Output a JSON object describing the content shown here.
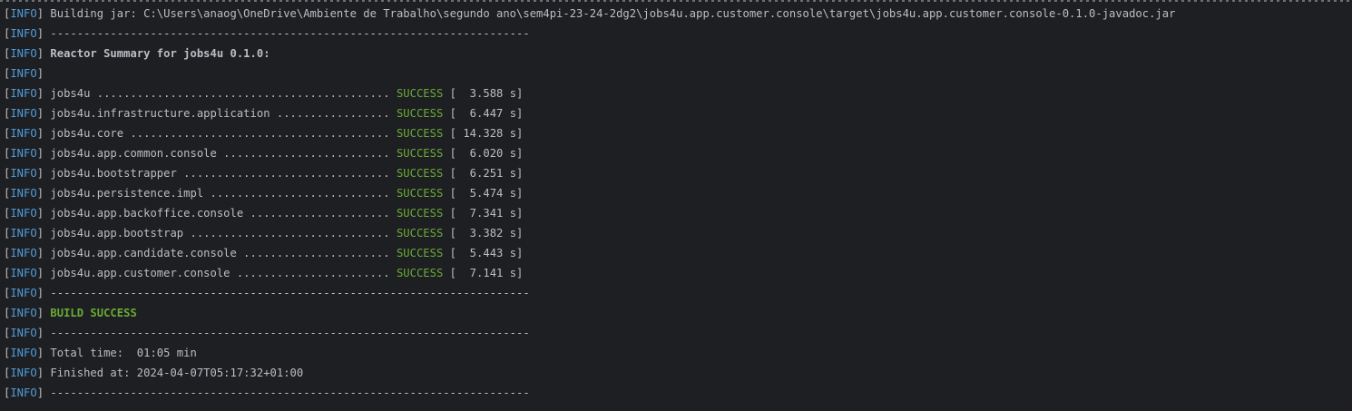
{
  "tag_open": "[",
  "tag_label": "INFO",
  "tag_close": "]",
  "colors": {
    "background": "#1e1f22",
    "text": "#bcbec4",
    "info_tag": "#4f9ddb",
    "success": "#6aab35"
  },
  "lines": {
    "building_jar": "Building jar: C:\\Users\\anaog\\OneDrive\\Ambiente de Trabalho\\segundo ano\\sem4pi-23-24-2dg2\\jobs4u.app.customer.console\\target\\jobs4u.app.customer.console-0.1.0-javadoc.jar",
    "separator": "------------------------------------------------------------------------",
    "reactor_summary": "Reactor Summary for jobs4u 0.1.0:",
    "empty": "",
    "build_success": "BUILD SUCCESS",
    "total_time": "Total time:  01:05 min",
    "finished_at": "Finished at: 2024-04-07T05:17:32+01:00"
  },
  "modules": [
    {
      "prefix": "jobs4u ............................................ ",
      "status": "SUCCESS",
      "time": " [  3.588 s]"
    },
    {
      "prefix": "jobs4u.infrastructure.application ................. ",
      "status": "SUCCESS",
      "time": " [  6.447 s]"
    },
    {
      "prefix": "jobs4u.core ....................................... ",
      "status": "SUCCESS",
      "time": " [ 14.328 s]"
    },
    {
      "prefix": "jobs4u.app.common.console ......................... ",
      "status": "SUCCESS",
      "time": " [  6.020 s]"
    },
    {
      "prefix": "jobs4u.bootstrapper ............................... ",
      "status": "SUCCESS",
      "time": " [  6.251 s]"
    },
    {
      "prefix": "jobs4u.persistence.impl ........................... ",
      "status": "SUCCESS",
      "time": " [  5.474 s]"
    },
    {
      "prefix": "jobs4u.app.backoffice.console ..................... ",
      "status": "SUCCESS",
      "time": " [  7.341 s]"
    },
    {
      "prefix": "jobs4u.app.bootstrap .............................. ",
      "status": "SUCCESS",
      "time": " [  3.382 s]"
    },
    {
      "prefix": "jobs4u.app.candidate.console ...................... ",
      "status": "SUCCESS",
      "time": " [  5.443 s]"
    },
    {
      "prefix": "jobs4u.app.customer.console ....................... ",
      "status": "SUCCESS",
      "time": " [  7.141 s]"
    }
  ]
}
